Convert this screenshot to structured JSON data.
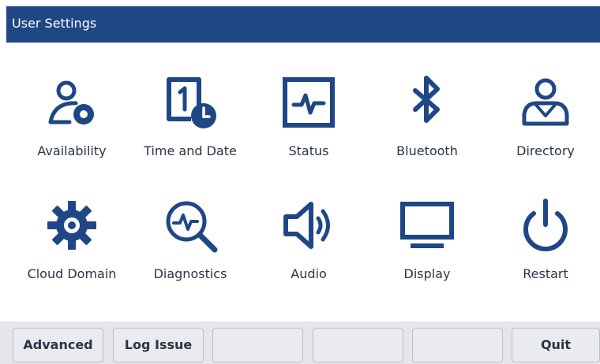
{
  "window": {
    "title": "User Settings"
  },
  "colors": {
    "header_bg": "#1f4785",
    "icon": "#1f4785",
    "softkey_bar": "#e4e6e9"
  },
  "menu": {
    "items": [
      {
        "label": "Availability",
        "icon": "availability-icon"
      },
      {
        "label": "Time and Date",
        "icon": "time-date-icon"
      },
      {
        "label": "Status",
        "icon": "status-icon"
      },
      {
        "label": "Bluetooth",
        "icon": "bluetooth-icon"
      },
      {
        "label": "Directory",
        "icon": "directory-icon"
      },
      {
        "label": "Cloud Domain",
        "icon": "gear-icon"
      },
      {
        "label": "Diagnostics",
        "icon": "diagnostics-icon"
      },
      {
        "label": "Audio",
        "icon": "speaker-icon"
      },
      {
        "label": "Display",
        "icon": "monitor-icon"
      },
      {
        "label": "Restart",
        "icon": "power-icon"
      }
    ]
  },
  "softkeys": [
    "Advanced",
    "Log Issue",
    "",
    "",
    "",
    "Quit"
  ]
}
